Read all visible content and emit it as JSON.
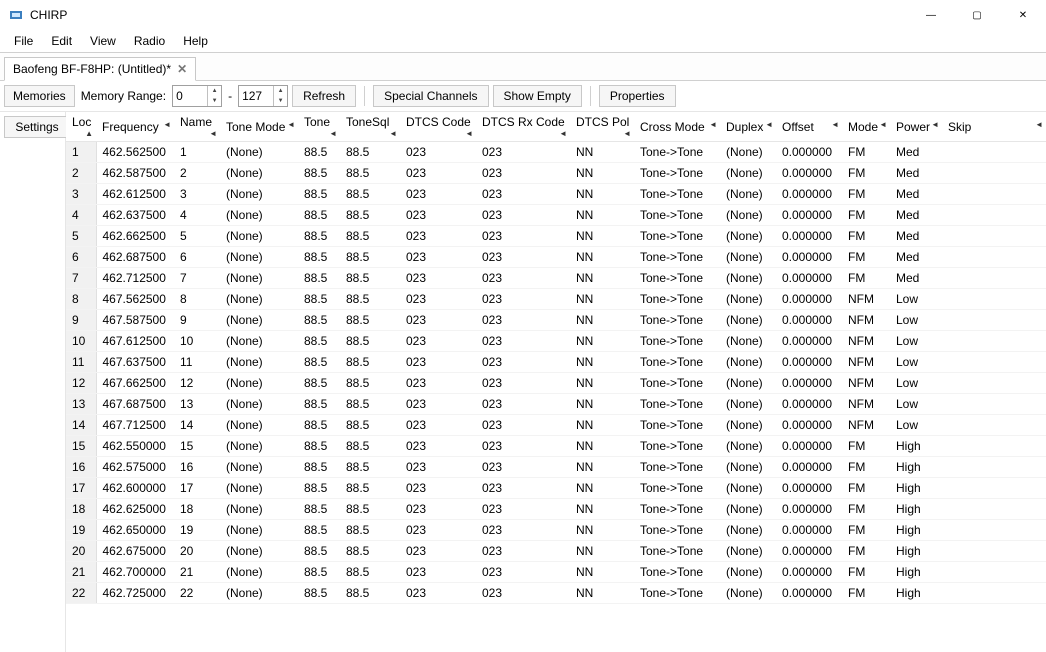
{
  "app": {
    "title": "CHIRP"
  },
  "window_controls": {
    "min": "—",
    "max": "▢",
    "close": "✕"
  },
  "menu": [
    "File",
    "Edit",
    "View",
    "Radio",
    "Help"
  ],
  "tab": {
    "label": "Baofeng BF-F8HP: (Untitled)*"
  },
  "side": {
    "memories": "Memories",
    "settings": "Settings"
  },
  "toolbar": {
    "range_label": "Memory Range:",
    "from": "0",
    "dash": "-",
    "to": "127",
    "refresh": "Refresh",
    "special": "Special Channels",
    "show_empty": "Show Empty",
    "properties": "Properties"
  },
  "columns": [
    "Loc",
    "Frequency",
    "Name",
    "Tone Mode",
    "Tone",
    "ToneSql",
    "DTCS Code",
    "DTCS Rx Code",
    "DTCS Pol",
    "Cross Mode",
    "Duplex",
    "Offset",
    "Mode",
    "Power",
    "Skip"
  ],
  "sort_glyph_up": "▲",
  "sort_glyph": "◄",
  "rows": [
    {
      "loc": "1",
      "freq": "462.562500",
      "name": "1",
      "tmode": "(None)",
      "tone": "88.5",
      "tsql": "88.5",
      "dtcs": "023",
      "dtcsr": "023",
      "dpol": "NN",
      "cross": "Tone->Tone",
      "dup": "(None)",
      "off": "0.000000",
      "mode": "FM",
      "pow": "Med",
      "skip": ""
    },
    {
      "loc": "2",
      "freq": "462.587500",
      "name": "2",
      "tmode": "(None)",
      "tone": "88.5",
      "tsql": "88.5",
      "dtcs": "023",
      "dtcsr": "023",
      "dpol": "NN",
      "cross": "Tone->Tone",
      "dup": "(None)",
      "off": "0.000000",
      "mode": "FM",
      "pow": "Med",
      "skip": ""
    },
    {
      "loc": "3",
      "freq": "462.612500",
      "name": "3",
      "tmode": "(None)",
      "tone": "88.5",
      "tsql": "88.5",
      "dtcs": "023",
      "dtcsr": "023",
      "dpol": "NN",
      "cross": "Tone->Tone",
      "dup": "(None)",
      "off": "0.000000",
      "mode": "FM",
      "pow": "Med",
      "skip": ""
    },
    {
      "loc": "4",
      "freq": "462.637500",
      "name": "4",
      "tmode": "(None)",
      "tone": "88.5",
      "tsql": "88.5",
      "dtcs": "023",
      "dtcsr": "023",
      "dpol": "NN",
      "cross": "Tone->Tone",
      "dup": "(None)",
      "off": "0.000000",
      "mode": "FM",
      "pow": "Med",
      "skip": ""
    },
    {
      "loc": "5",
      "freq": "462.662500",
      "name": "5",
      "tmode": "(None)",
      "tone": "88.5",
      "tsql": "88.5",
      "dtcs": "023",
      "dtcsr": "023",
      "dpol": "NN",
      "cross": "Tone->Tone",
      "dup": "(None)",
      "off": "0.000000",
      "mode": "FM",
      "pow": "Med",
      "skip": ""
    },
    {
      "loc": "6",
      "freq": "462.687500",
      "name": "6",
      "tmode": "(None)",
      "tone": "88.5",
      "tsql": "88.5",
      "dtcs": "023",
      "dtcsr": "023",
      "dpol": "NN",
      "cross": "Tone->Tone",
      "dup": "(None)",
      "off": "0.000000",
      "mode": "FM",
      "pow": "Med",
      "skip": ""
    },
    {
      "loc": "7",
      "freq": "462.712500",
      "name": "7",
      "tmode": "(None)",
      "tone": "88.5",
      "tsql": "88.5",
      "dtcs": "023",
      "dtcsr": "023",
      "dpol": "NN",
      "cross": "Tone->Tone",
      "dup": "(None)",
      "off": "0.000000",
      "mode": "FM",
      "pow": "Med",
      "skip": ""
    },
    {
      "loc": "8",
      "freq": "467.562500",
      "name": "8",
      "tmode": "(None)",
      "tone": "88.5",
      "tsql": "88.5",
      "dtcs": "023",
      "dtcsr": "023",
      "dpol": "NN",
      "cross": "Tone->Tone",
      "dup": "(None)",
      "off": "0.000000",
      "mode": "NFM",
      "pow": "Low",
      "skip": ""
    },
    {
      "loc": "9",
      "freq": "467.587500",
      "name": "9",
      "tmode": "(None)",
      "tone": "88.5",
      "tsql": "88.5",
      "dtcs": "023",
      "dtcsr": "023",
      "dpol": "NN",
      "cross": "Tone->Tone",
      "dup": "(None)",
      "off": "0.000000",
      "mode": "NFM",
      "pow": "Low",
      "skip": ""
    },
    {
      "loc": "10",
      "freq": "467.612500",
      "name": "10",
      "tmode": "(None)",
      "tone": "88.5",
      "tsql": "88.5",
      "dtcs": "023",
      "dtcsr": "023",
      "dpol": "NN",
      "cross": "Tone->Tone",
      "dup": "(None)",
      "off": "0.000000",
      "mode": "NFM",
      "pow": "Low",
      "skip": ""
    },
    {
      "loc": "11",
      "freq": "467.637500",
      "name": "11",
      "tmode": "(None)",
      "tone": "88.5",
      "tsql": "88.5",
      "dtcs": "023",
      "dtcsr": "023",
      "dpol": "NN",
      "cross": "Tone->Tone",
      "dup": "(None)",
      "off": "0.000000",
      "mode": "NFM",
      "pow": "Low",
      "skip": ""
    },
    {
      "loc": "12",
      "freq": "467.662500",
      "name": "12",
      "tmode": "(None)",
      "tone": "88.5",
      "tsql": "88.5",
      "dtcs": "023",
      "dtcsr": "023",
      "dpol": "NN",
      "cross": "Tone->Tone",
      "dup": "(None)",
      "off": "0.000000",
      "mode": "NFM",
      "pow": "Low",
      "skip": ""
    },
    {
      "loc": "13",
      "freq": "467.687500",
      "name": "13",
      "tmode": "(None)",
      "tone": "88.5",
      "tsql": "88.5",
      "dtcs": "023",
      "dtcsr": "023",
      "dpol": "NN",
      "cross": "Tone->Tone",
      "dup": "(None)",
      "off": "0.000000",
      "mode": "NFM",
      "pow": "Low",
      "skip": ""
    },
    {
      "loc": "14",
      "freq": "467.712500",
      "name": "14",
      "tmode": "(None)",
      "tone": "88.5",
      "tsql": "88.5",
      "dtcs": "023",
      "dtcsr": "023",
      "dpol": "NN",
      "cross": "Tone->Tone",
      "dup": "(None)",
      "off": "0.000000",
      "mode": "NFM",
      "pow": "Low",
      "skip": ""
    },
    {
      "loc": "15",
      "freq": "462.550000",
      "name": "15",
      "tmode": "(None)",
      "tone": "88.5",
      "tsql": "88.5",
      "dtcs": "023",
      "dtcsr": "023",
      "dpol": "NN",
      "cross": "Tone->Tone",
      "dup": "(None)",
      "off": "0.000000",
      "mode": "FM",
      "pow": "High",
      "skip": ""
    },
    {
      "loc": "16",
      "freq": "462.575000",
      "name": "16",
      "tmode": "(None)",
      "tone": "88.5",
      "tsql": "88.5",
      "dtcs": "023",
      "dtcsr": "023",
      "dpol": "NN",
      "cross": "Tone->Tone",
      "dup": "(None)",
      "off": "0.000000",
      "mode": "FM",
      "pow": "High",
      "skip": ""
    },
    {
      "loc": "17",
      "freq": "462.600000",
      "name": "17",
      "tmode": "(None)",
      "tone": "88.5",
      "tsql": "88.5",
      "dtcs": "023",
      "dtcsr": "023",
      "dpol": "NN",
      "cross": "Tone->Tone",
      "dup": "(None)",
      "off": "0.000000",
      "mode": "FM",
      "pow": "High",
      "skip": ""
    },
    {
      "loc": "18",
      "freq": "462.625000",
      "name": "18",
      "tmode": "(None)",
      "tone": "88.5",
      "tsql": "88.5",
      "dtcs": "023",
      "dtcsr": "023",
      "dpol": "NN",
      "cross": "Tone->Tone",
      "dup": "(None)",
      "off": "0.000000",
      "mode": "FM",
      "pow": "High",
      "skip": ""
    },
    {
      "loc": "19",
      "freq": "462.650000",
      "name": "19",
      "tmode": "(None)",
      "tone": "88.5",
      "tsql": "88.5",
      "dtcs": "023",
      "dtcsr": "023",
      "dpol": "NN",
      "cross": "Tone->Tone",
      "dup": "(None)",
      "off": "0.000000",
      "mode": "FM",
      "pow": "High",
      "skip": ""
    },
    {
      "loc": "20",
      "freq": "462.675000",
      "name": "20",
      "tmode": "(None)",
      "tone": "88.5",
      "tsql": "88.5",
      "dtcs": "023",
      "dtcsr": "023",
      "dpol": "NN",
      "cross": "Tone->Tone",
      "dup": "(None)",
      "off": "0.000000",
      "mode": "FM",
      "pow": "High",
      "skip": ""
    },
    {
      "loc": "21",
      "freq": "462.700000",
      "name": "21",
      "tmode": "(None)",
      "tone": "88.5",
      "tsql": "88.5",
      "dtcs": "023",
      "dtcsr": "023",
      "dpol": "NN",
      "cross": "Tone->Tone",
      "dup": "(None)",
      "off": "0.000000",
      "mode": "FM",
      "pow": "High",
      "skip": ""
    },
    {
      "loc": "22",
      "freq": "462.725000",
      "name": "22",
      "tmode": "(None)",
      "tone": "88.5",
      "tsql": "88.5",
      "dtcs": "023",
      "dtcsr": "023",
      "dpol": "NN",
      "cross": "Tone->Tone",
      "dup": "(None)",
      "off": "0.000000",
      "mode": "FM",
      "pow": "High",
      "skip": ""
    }
  ]
}
